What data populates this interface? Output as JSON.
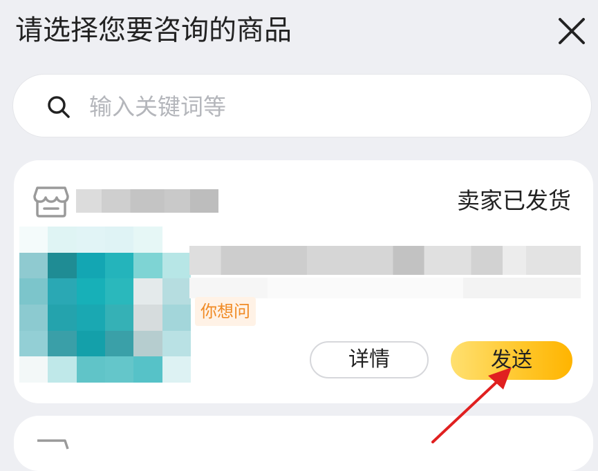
{
  "header": {
    "title": "请选择您要咨询的商品",
    "close_icon": "close-icon"
  },
  "search": {
    "icon": "search-icon",
    "placeholder": "输入关键词等",
    "value": ""
  },
  "orders": [
    {
      "shop_icon": "store-icon",
      "status": "卖家已发货",
      "tag": "你想问",
      "detail_label": "详情",
      "send_label": "发送"
    }
  ],
  "colors": {
    "background": "#eeeff3",
    "card": "#ffffff",
    "send_button": "#ffc629",
    "tag_text": "#f08a24",
    "annotation_arrow": "#e02020"
  }
}
